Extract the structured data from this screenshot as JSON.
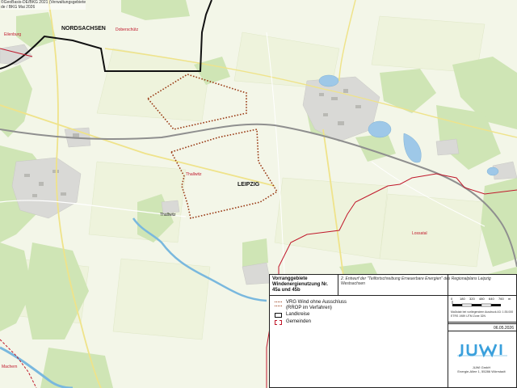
{
  "attribution": {
    "line1": "©GeoBasis-DE/BKG 2021 (Verwaltungsgebiete",
    "line2": "de / BKG Mai 2026"
  },
  "places": {
    "nordsachsen": "NORDSACHSEN",
    "leipzig": "LEIPZIG",
    "eilenburg": "Eilenburg",
    "doberschuetz": "Doberschütz",
    "thallwitz_red": "Thallwitz",
    "thallwitz_black": "Thallwitz",
    "lossatal": "Lossatal",
    "machern": "Machern"
  },
  "legend": {
    "title": "Vorranggebiete Windenergienutzung Nr. 45a und 45b",
    "note": "2. Entwurf der \"Teilfortschreibung Erneuerbare Energien\" des Regionalplans Leipzig Westsachsen",
    "items": [
      {
        "label": "VRG Wind ohne Ausschluss",
        "sub": "(RROP im Verfahren)",
        "symbol": "dotted-brown"
      },
      {
        "label": "Landkreise",
        "symbol": "black-box"
      },
      {
        "label": "Gemeinden",
        "symbol": "red-dashed"
      }
    ]
  },
  "scalebar": {
    "ticks": [
      "0",
      "180",
      "320",
      "480",
      "640",
      "760"
    ],
    "unit": "m",
    "info_lines": [
      "Maßstab bei vorliegendem Ausdruck A3: 1:35.000",
      "ETRS 1989 UTM Zone 32N"
    ]
  },
  "date": "06.05.2026",
  "company": {
    "logo_text": "JUWI",
    "lines": [
      "JUWI GmbH",
      "Energie-Allee 1, 55286 Wörrstadt"
    ]
  },
  "colors": {
    "forest": "#cfe5b5",
    "settlement": "#d7d7d7",
    "water": "#9ec8e8",
    "river": "#79b8de",
    "district": "#111111",
    "municipality": "#c0182b",
    "vrg": "#9a3b16",
    "logo": "#3aa0dc"
  }
}
